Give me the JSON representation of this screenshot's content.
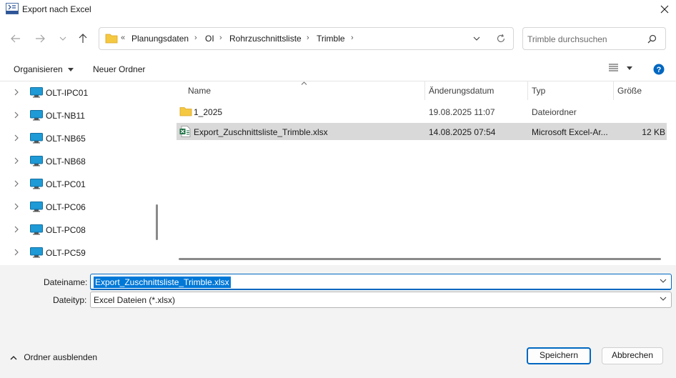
{
  "window": {
    "title": "Export nach Excel"
  },
  "address": {
    "overflow": "«",
    "crumbs": [
      "Planungsdaten",
      "OI",
      "Rohrzuschnittsliste",
      "Trimble"
    ]
  },
  "search": {
    "placeholder": "Trimble durchsuchen"
  },
  "toolbar": {
    "organize": "Organisieren",
    "new_folder": "Neuer Ordner"
  },
  "tree": {
    "items": [
      {
        "label": "OLT-IPC01"
      },
      {
        "label": "OLT-NB11"
      },
      {
        "label": "OLT-NB65"
      },
      {
        "label": "OLT-NB68"
      },
      {
        "label": "OLT-PC01"
      },
      {
        "label": "OLT-PC06"
      },
      {
        "label": "OLT-PC08"
      },
      {
        "label": "OLT-PC59"
      }
    ]
  },
  "filelist": {
    "columns": {
      "name": "Name",
      "modified": "Änderungsdatum",
      "type": "Typ",
      "size": "Größe"
    },
    "rows": [
      {
        "name": "1_2025",
        "modified": "19.08.2025 11:07",
        "type": "Dateiordner",
        "size": "",
        "icon": "folder-icon"
      },
      {
        "name": "Export_Zuschnittsliste_Trimble.xlsx",
        "modified": "14.08.2025 07:54",
        "type": "Microsoft Excel-Ar...",
        "size": "12 KB",
        "icon": "excel-file-icon"
      }
    ]
  },
  "form": {
    "filename_label": "Dateiname:",
    "filename_value": "Export_Zuschnittsliste_Trimble.xlsx",
    "filetype_label": "Dateityp:",
    "filetype_value": "Excel Dateien (*.xlsx)"
  },
  "footer": {
    "hide_folders": "Ordner ausblenden",
    "save": "Speichern",
    "cancel": "Abbrechen"
  },
  "colors": {
    "accent": "#0067c0",
    "selection": "#0078d7",
    "folder": "#f5c842",
    "monitor": "#1e9ad6",
    "excel": "#1d7044"
  }
}
